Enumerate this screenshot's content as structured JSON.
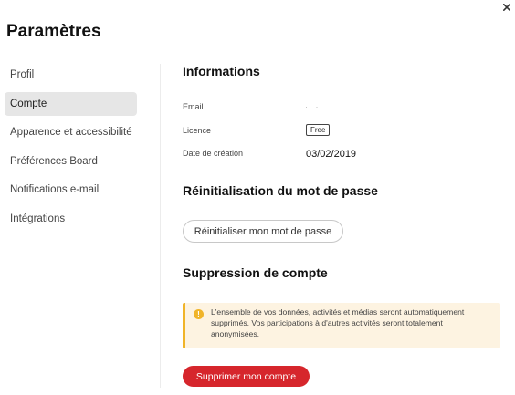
{
  "window": {
    "title": "Paramètres",
    "close_icon": "close-icon"
  },
  "sidebar": {
    "items": [
      {
        "label": "Profil",
        "active": false
      },
      {
        "label": "Compte",
        "active": true
      },
      {
        "label": "Apparence et accessibilité",
        "active": false
      },
      {
        "label": "Préférences Board",
        "active": false
      },
      {
        "label": "Notifications e-mail",
        "active": false
      },
      {
        "label": "Intégrations",
        "active": false
      }
    ]
  },
  "informations": {
    "title": "Informations",
    "email_label": "Email",
    "email_value": "· ·",
    "licence_label": "Licence",
    "licence_value": "Free",
    "creation_label": "Date de création",
    "creation_value": "03/02/2019"
  },
  "password_reset": {
    "title": "Réinitialisation du mot de passe",
    "button_label": "Réinitialiser mon mot de passe"
  },
  "account_deletion": {
    "title": "Suppression de compte",
    "warning_icon": "warning-icon",
    "warning_text": "L'ensemble de vos données, activités et médias seront automatiquement supprimés. Vos participations à d'autres activités seront totalement anonymisées.",
    "button_label": "Supprimer mon compte"
  },
  "colors": {
    "accent_red": "#d6262c",
    "warning_bg": "#fdf3e1",
    "warning_border": "#f0b429",
    "active_nav_bg": "#e6e6e6"
  }
}
